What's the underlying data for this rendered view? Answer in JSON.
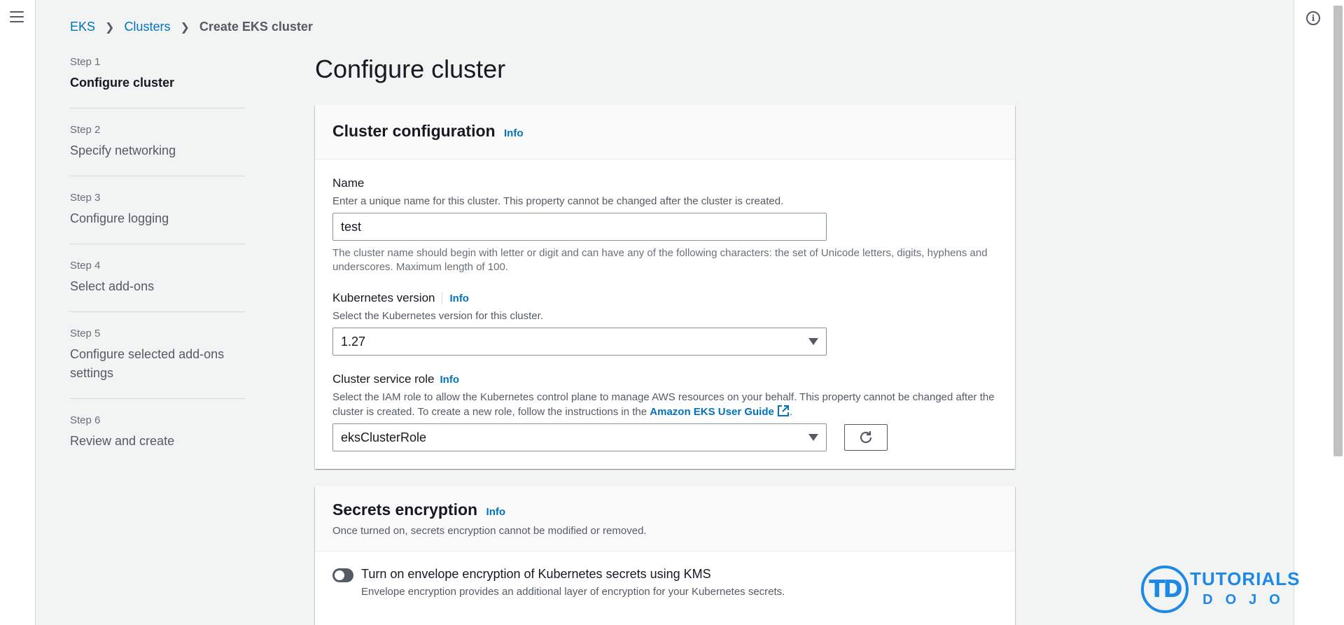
{
  "breadcrumb": [
    {
      "label": "EKS"
    },
    {
      "label": "Clusters"
    },
    {
      "label": "Create EKS cluster"
    }
  ],
  "steps": [
    {
      "num": "Step 1",
      "title": "Configure cluster",
      "active": true
    },
    {
      "num": "Step 2",
      "title": "Specify networking"
    },
    {
      "num": "Step 3",
      "title": "Configure logging"
    },
    {
      "num": "Step 4",
      "title": "Select add-ons"
    },
    {
      "num": "Step 5",
      "title": "Configure selected add-ons settings"
    },
    {
      "num": "Step 6",
      "title": "Review and create"
    }
  ],
  "page_title": "Configure cluster",
  "cluster_config": {
    "title": "Cluster configuration",
    "info": "Info",
    "name": {
      "label": "Name",
      "description": "Enter a unique name for this cluster. This property cannot be changed after the cluster is created.",
      "value": "test",
      "hint": "The cluster name should begin with letter or digit and can have any of the following characters: the set of Unicode letters, digits, hyphens and underscores. Maximum length of 100."
    },
    "k8s_version": {
      "label": "Kubernetes version",
      "info": "Info",
      "description": "Select the Kubernetes version for this cluster.",
      "selected": "1.27"
    },
    "service_role": {
      "label": "Cluster service role",
      "info": "Info",
      "description_pre": "Select the IAM role to allow the Kubernetes control plane to manage AWS resources on your behalf. This property cannot be changed after the cluster is created. To create a new role, follow the instructions in the",
      "link_text": "Amazon EKS User Guide",
      "description_post": ".",
      "selected": "eksClusterRole"
    }
  },
  "secrets": {
    "title": "Secrets encryption",
    "info": "Info",
    "subtitle": "Once turned on, secrets encryption cannot be modified or removed.",
    "toggle_label": "Turn on envelope encryption of Kubernetes secrets using KMS",
    "toggle_desc": "Envelope encryption provides an additional layer of encryption for your Kubernetes secrets.",
    "toggle_on": false
  },
  "watermark": {
    "mark": "TD",
    "line1": "TUTORIALS",
    "line2": "DOJO"
  },
  "icons": {
    "menu": "hamburger-menu-icon",
    "help": "info-circle-icon",
    "external": "external-link-icon",
    "refresh": "refresh-icon",
    "dropdown": "caret-down-icon"
  },
  "colors": {
    "link": "#0073bb",
    "text": "#16191f",
    "muted": "#545b64",
    "background": "#f2f3f3",
    "logo": "#1e88e5"
  }
}
